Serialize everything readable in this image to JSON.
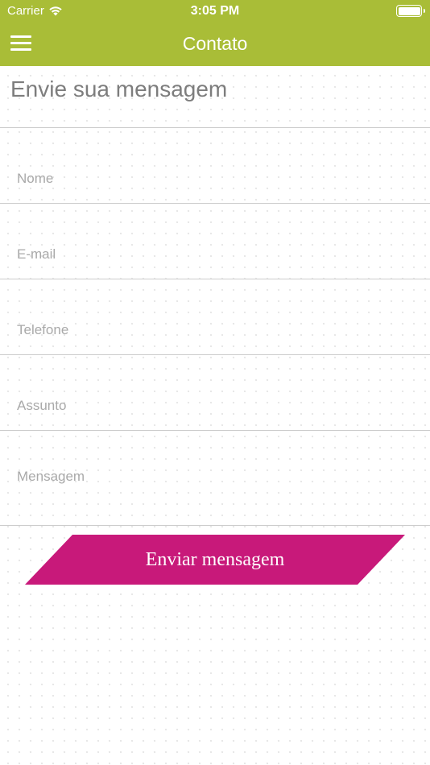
{
  "status_bar": {
    "carrier": "Carrier",
    "time": "3:05 PM",
    "icons": [
      "wifi-icon",
      "battery-icon"
    ]
  },
  "header": {
    "title": "Contato",
    "menu_icon": "hamburger-menu-icon",
    "background_color": "#a9bd37"
  },
  "form": {
    "heading": "Envie sua mensagem",
    "fields": {
      "nome": {
        "placeholder": "Nome",
        "value": ""
      },
      "email": {
        "placeholder": "E-mail",
        "value": ""
      },
      "telefone": {
        "placeholder": "Telefone",
        "value": ""
      },
      "assunto": {
        "placeholder": "Assunto",
        "value": ""
      },
      "mensagem": {
        "placeholder": "Mensagem",
        "value": ""
      }
    },
    "submit_label": "Enviar mensagem",
    "submit_color": "#c8197a"
  }
}
